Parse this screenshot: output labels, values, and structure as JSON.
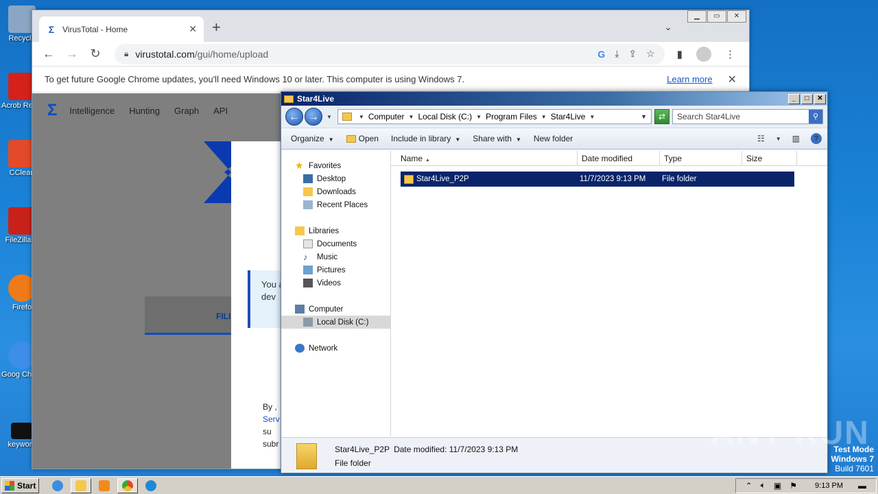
{
  "desktop": {
    "icons": [
      {
        "label": "Recycle",
        "color": "#8aa6c4"
      },
      {
        "label": "Acrob Reader",
        "color": "#d4211a"
      },
      {
        "label": "CClean",
        "color": "#e24a2a"
      },
      {
        "label": "FileZilla C",
        "color": "#c8211a"
      },
      {
        "label": "Firefo",
        "color": "#ef7a1a"
      },
      {
        "label": "Goog Chron",
        "color": "#3d8ee8"
      },
      {
        "label": "keyword",
        "color": "#111111"
      }
    ]
  },
  "chrome": {
    "tab_title": "VirusTotal - Home",
    "tab_close": "✕",
    "new_tab": "+",
    "url_host": "virustotal.com",
    "url_path": "/gui/home/upload",
    "infobar_message": "To get future Google Chrome updates, you'll need Windows 10 or later. This computer is using Windows 7.",
    "learn_more": "Learn more",
    "vt_nav": [
      "Intelligence",
      "Hunting",
      "Graph",
      "API"
    ],
    "vt_tab_file": "FILI",
    "vt_notice_line1": "You a",
    "vt_notice_line2": "dev",
    "vt_foot_line1": "By ,",
    "vt_foot_line2": "Serv",
    "vt_foot_line3": "su",
    "vt_foot_line4": "subr"
  },
  "explorer": {
    "title": "Star4Live",
    "breadcrumbs": [
      "Computer",
      "Local Disk (C:)",
      "Program Files",
      "Star4Live"
    ],
    "search_placeholder": "Search Star4Live",
    "commands": {
      "organize": "Organize",
      "open": "Open",
      "include": "Include in library",
      "share": "Share with",
      "new_folder": "New folder"
    },
    "nav": {
      "favorites": "Favorites",
      "desktop": "Desktop",
      "downloads": "Downloads",
      "recent": "Recent Places",
      "libraries": "Libraries",
      "documents": "Documents",
      "music": "Music",
      "pictures": "Pictures",
      "videos": "Videos",
      "computer": "Computer",
      "local_disk": "Local Disk (C:)",
      "network": "Network"
    },
    "columns": {
      "name": "Name",
      "date": "Date modified",
      "type": "Type",
      "size": "Size"
    },
    "files": [
      {
        "name": "Star4Live_P2P",
        "date": "11/7/2023 9:13 PM",
        "type": "File folder"
      }
    ],
    "status": {
      "name": "Star4Live_P2P",
      "date_modified": "Date modified: 11/7/2023 9:13 PM",
      "type": "File folder"
    }
  },
  "taskbar": {
    "start": "Start",
    "clock": "9:13 PM"
  },
  "watermark": "ANY RUN",
  "testmode": {
    "line1": "Test Mode",
    "line2": "Windows 7",
    "line3": "Build 7601"
  }
}
